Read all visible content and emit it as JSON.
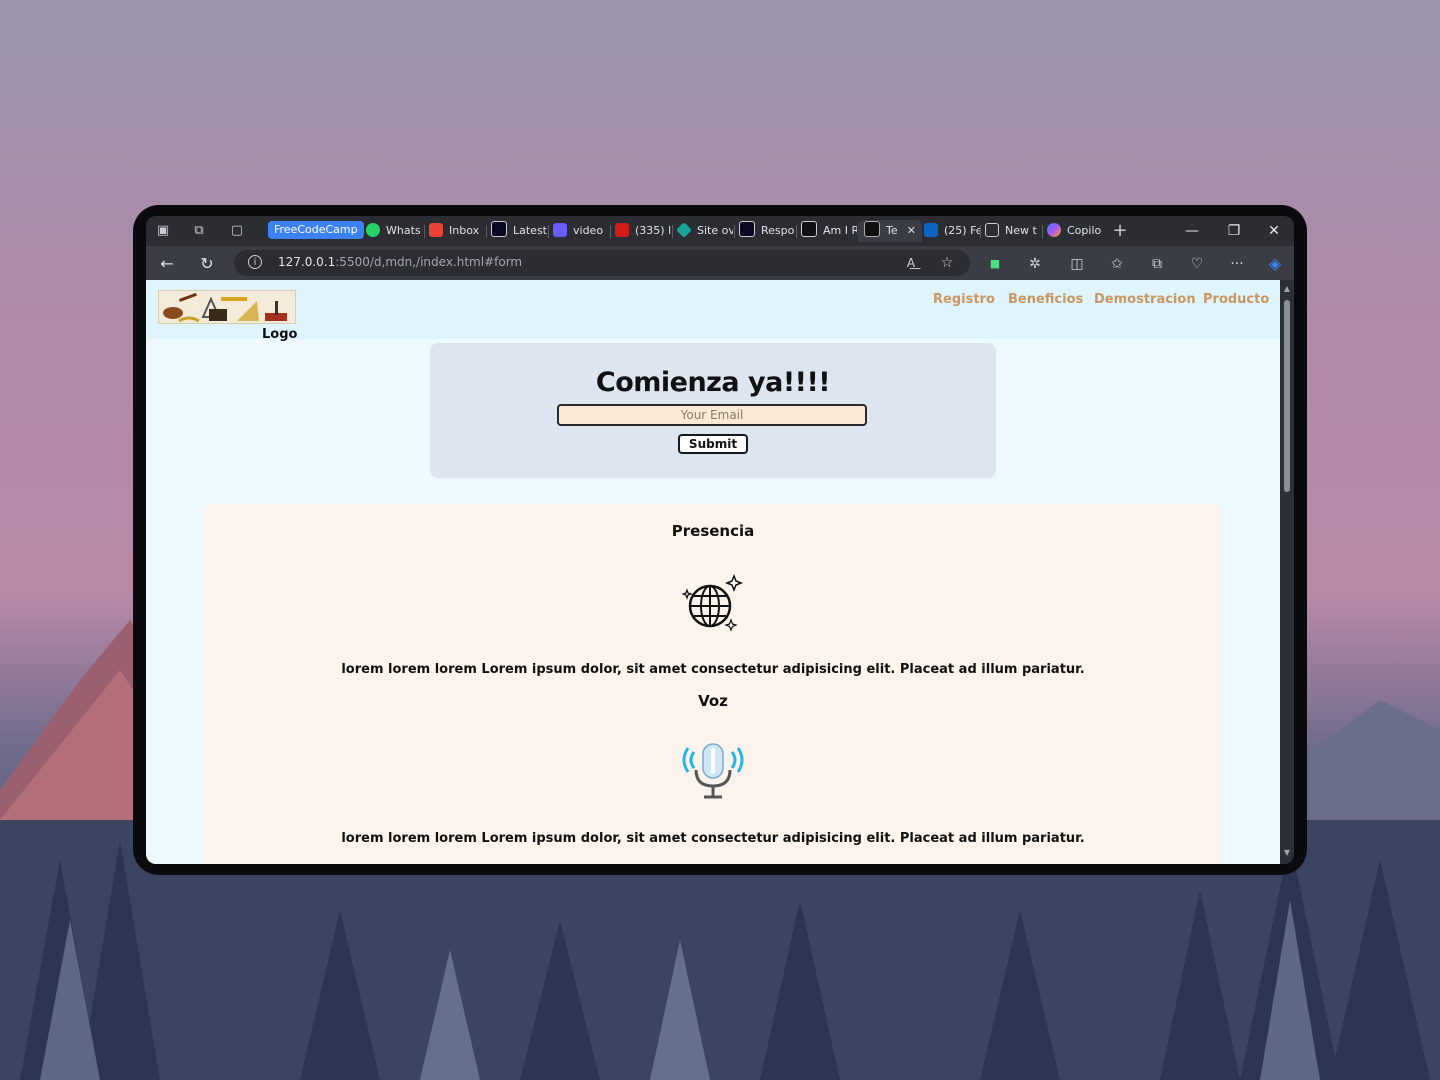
{
  "browser": {
    "tab_group_label": "FreeCodeCamp",
    "tabs": [
      {
        "label": "Whats",
        "color": "#25d366"
      },
      {
        "label": "Inbox",
        "color": "#ea4335"
      },
      {
        "label": "Latest",
        "color": "#ffffff"
      },
      {
        "label": "video",
        "color": "#6b5cff"
      },
      {
        "label": "(335) l",
        "color": "#d31b1b"
      },
      {
        "label": "Site ov",
        "color": "#17a398"
      },
      {
        "label": "Respo",
        "color": "#ffffff"
      },
      {
        "label": "Am I R",
        "color": "#ffffff"
      },
      {
        "label": "Te",
        "color": "#ffffff"
      },
      {
        "label": "(25) Fe",
        "color": "#0a66c2"
      },
      {
        "label": "New t",
        "color": "#cccccc"
      },
      {
        "label": "Copilo",
        "color": "#a855f7"
      }
    ],
    "url_host": "127.0.0.1",
    "url_rest": ":5500/d,mdn,/index.html#form"
  },
  "site": {
    "logo_label": "Logo",
    "nav": [
      "Registro",
      "Beneficios",
      "Demostracion",
      "Producto"
    ],
    "hero": {
      "title": "Comienza ya!!!!",
      "email_placeholder": "Your Email",
      "submit_label": "Submit"
    },
    "features": [
      {
        "title": "Presencia",
        "icon": "globe-icon",
        "text": "lorem lorem lorem Lorem ipsum dolor, sit amet consectetur adipisicing elit. Placeat ad illum pariatur."
      },
      {
        "title": "Voz",
        "icon": "microphone-icon",
        "text": "lorem lorem lorem Lorem ipsum dolor, sit amet consectetur adipisicing elit. Placeat ad illum pariatur."
      }
    ],
    "colors": {
      "nav_link": "#c9975f",
      "hero_bg": "#dde6f0",
      "features_bg": "#fbf3ec"
    }
  }
}
